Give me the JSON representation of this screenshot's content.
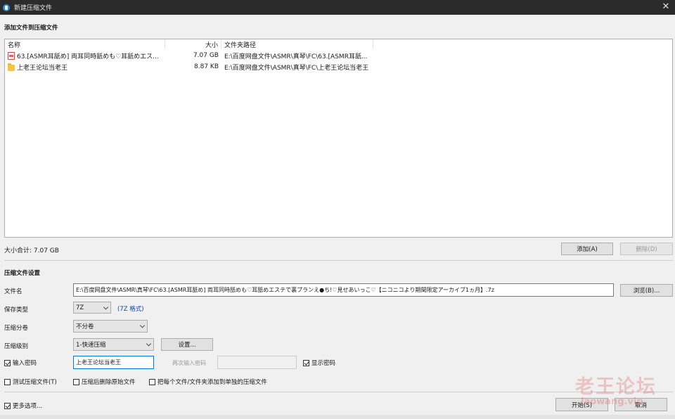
{
  "window": {
    "title": "新建压缩文件"
  },
  "add_section": {
    "heading": "添加文件到压缩文件"
  },
  "file_list": {
    "columns": {
      "name": "名称",
      "size": "大小",
      "path": "文件夹路径"
    },
    "rows": [
      {
        "name": "63.[ASMR耳舐め] 両耳同時舐めも♡耳舐めエス...",
        "size": "7.07 GB",
        "path": "E:\\百度网盘文件\\ASMR\\真琴\\FC\\63.[ASMR耳舐...",
        "icon": "document-icon"
      },
      {
        "name": "上老王论坛当老王",
        "size": "8.87 KB",
        "path": "E:\\百度网盘文件\\ASMR\\真琴\\FC\\上老王论坛当老王",
        "icon": "folder-icon"
      }
    ]
  },
  "total_size": "大小合计: 7.07 GB",
  "buttons": {
    "add": "添加(A)",
    "delete": "删除(D)",
    "browse": "浏览(B)...",
    "settings": "设置...",
    "start": "开始(S)",
    "cancel": "取消"
  },
  "settings_section": {
    "heading": "压缩文件设置"
  },
  "form": {
    "filename_label": "文件名",
    "filename_value": "E:\\百度网盘文件\\ASMR\\真琴\\FC\\63.[ASMR耳舐め] 両耳同時舐めも♡耳舐めエステで裏プランえ●ち!♡見せあいっこ♡【ニコニコより期間限定アーカイブ1ヵ月】.7z",
    "format_label": "保存类型",
    "format_value": "7Z",
    "format_link": "(7Z 格式)",
    "split_label": "压缩分卷",
    "split_value": "不分卷",
    "level_label": "压缩级别",
    "level_value": "1-快速压缩",
    "password_label": "输入密码",
    "password_value": "上老王论坛当老王",
    "password_confirm_placeholder": "再次输入密码",
    "show_password_label": "显示密码"
  },
  "options": {
    "test_archive": "测试压缩文件(T)",
    "delete_after": "压缩后删除原始文件",
    "separate_archives": "把每个文件/文件夹添加到单独的压缩文件",
    "more_options": "更多选项..."
  },
  "checks": {
    "password_enabled": true,
    "show_password": true,
    "test_archive": false,
    "delete_after": false,
    "separate_archives": false,
    "more_options": true
  },
  "watermark": {
    "text": "老王论坛",
    "sub": "laowang.vip"
  }
}
